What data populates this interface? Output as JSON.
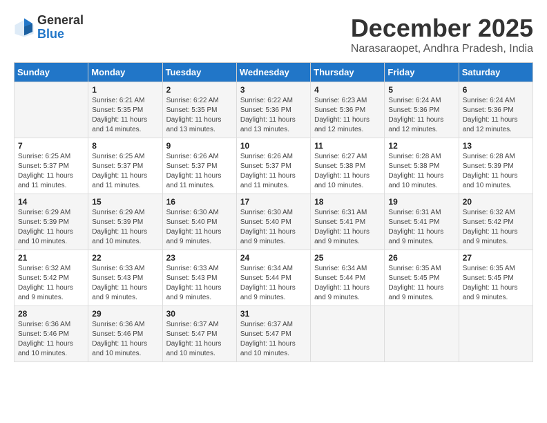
{
  "logo": {
    "general": "General",
    "blue": "Blue"
  },
  "title": "December 2025",
  "location": "Narasaraopet, Andhra Pradesh, India",
  "weekdays": [
    "Sunday",
    "Monday",
    "Tuesday",
    "Wednesday",
    "Thursday",
    "Friday",
    "Saturday"
  ],
  "weeks": [
    [
      {
        "day": "",
        "sunrise": "",
        "sunset": "",
        "daylight": ""
      },
      {
        "day": "1",
        "sunrise": "Sunrise: 6:21 AM",
        "sunset": "Sunset: 5:35 PM",
        "daylight": "Daylight: 11 hours and 14 minutes."
      },
      {
        "day": "2",
        "sunrise": "Sunrise: 6:22 AM",
        "sunset": "Sunset: 5:35 PM",
        "daylight": "Daylight: 11 hours and 13 minutes."
      },
      {
        "day": "3",
        "sunrise": "Sunrise: 6:22 AM",
        "sunset": "Sunset: 5:36 PM",
        "daylight": "Daylight: 11 hours and 13 minutes."
      },
      {
        "day": "4",
        "sunrise": "Sunrise: 6:23 AM",
        "sunset": "Sunset: 5:36 PM",
        "daylight": "Daylight: 11 hours and 12 minutes."
      },
      {
        "day": "5",
        "sunrise": "Sunrise: 6:24 AM",
        "sunset": "Sunset: 5:36 PM",
        "daylight": "Daylight: 11 hours and 12 minutes."
      },
      {
        "day": "6",
        "sunrise": "Sunrise: 6:24 AM",
        "sunset": "Sunset: 5:36 PM",
        "daylight": "Daylight: 11 hours and 12 minutes."
      }
    ],
    [
      {
        "day": "7",
        "sunrise": "Sunrise: 6:25 AM",
        "sunset": "Sunset: 5:37 PM",
        "daylight": "Daylight: 11 hours and 11 minutes."
      },
      {
        "day": "8",
        "sunrise": "Sunrise: 6:25 AM",
        "sunset": "Sunset: 5:37 PM",
        "daylight": "Daylight: 11 hours and 11 minutes."
      },
      {
        "day": "9",
        "sunrise": "Sunrise: 6:26 AM",
        "sunset": "Sunset: 5:37 PM",
        "daylight": "Daylight: 11 hours and 11 minutes."
      },
      {
        "day": "10",
        "sunrise": "Sunrise: 6:26 AM",
        "sunset": "Sunset: 5:37 PM",
        "daylight": "Daylight: 11 hours and 11 minutes."
      },
      {
        "day": "11",
        "sunrise": "Sunrise: 6:27 AM",
        "sunset": "Sunset: 5:38 PM",
        "daylight": "Daylight: 11 hours and 10 minutes."
      },
      {
        "day": "12",
        "sunrise": "Sunrise: 6:28 AM",
        "sunset": "Sunset: 5:38 PM",
        "daylight": "Daylight: 11 hours and 10 minutes."
      },
      {
        "day": "13",
        "sunrise": "Sunrise: 6:28 AM",
        "sunset": "Sunset: 5:39 PM",
        "daylight": "Daylight: 11 hours and 10 minutes."
      }
    ],
    [
      {
        "day": "14",
        "sunrise": "Sunrise: 6:29 AM",
        "sunset": "Sunset: 5:39 PM",
        "daylight": "Daylight: 11 hours and 10 minutes."
      },
      {
        "day": "15",
        "sunrise": "Sunrise: 6:29 AM",
        "sunset": "Sunset: 5:39 PM",
        "daylight": "Daylight: 11 hours and 10 minutes."
      },
      {
        "day": "16",
        "sunrise": "Sunrise: 6:30 AM",
        "sunset": "Sunset: 5:40 PM",
        "daylight": "Daylight: 11 hours and 9 minutes."
      },
      {
        "day": "17",
        "sunrise": "Sunrise: 6:30 AM",
        "sunset": "Sunset: 5:40 PM",
        "daylight": "Daylight: 11 hours and 9 minutes."
      },
      {
        "day": "18",
        "sunrise": "Sunrise: 6:31 AM",
        "sunset": "Sunset: 5:41 PM",
        "daylight": "Daylight: 11 hours and 9 minutes."
      },
      {
        "day": "19",
        "sunrise": "Sunrise: 6:31 AM",
        "sunset": "Sunset: 5:41 PM",
        "daylight": "Daylight: 11 hours and 9 minutes."
      },
      {
        "day": "20",
        "sunrise": "Sunrise: 6:32 AM",
        "sunset": "Sunset: 5:42 PM",
        "daylight": "Daylight: 11 hours and 9 minutes."
      }
    ],
    [
      {
        "day": "21",
        "sunrise": "Sunrise: 6:32 AM",
        "sunset": "Sunset: 5:42 PM",
        "daylight": "Daylight: 11 hours and 9 minutes."
      },
      {
        "day": "22",
        "sunrise": "Sunrise: 6:33 AM",
        "sunset": "Sunset: 5:43 PM",
        "daylight": "Daylight: 11 hours and 9 minutes."
      },
      {
        "day": "23",
        "sunrise": "Sunrise: 6:33 AM",
        "sunset": "Sunset: 5:43 PM",
        "daylight": "Daylight: 11 hours and 9 minutes."
      },
      {
        "day": "24",
        "sunrise": "Sunrise: 6:34 AM",
        "sunset": "Sunset: 5:44 PM",
        "daylight": "Daylight: 11 hours and 9 minutes."
      },
      {
        "day": "25",
        "sunrise": "Sunrise: 6:34 AM",
        "sunset": "Sunset: 5:44 PM",
        "daylight": "Daylight: 11 hours and 9 minutes."
      },
      {
        "day": "26",
        "sunrise": "Sunrise: 6:35 AM",
        "sunset": "Sunset: 5:45 PM",
        "daylight": "Daylight: 11 hours and 9 minutes."
      },
      {
        "day": "27",
        "sunrise": "Sunrise: 6:35 AM",
        "sunset": "Sunset: 5:45 PM",
        "daylight": "Daylight: 11 hours and 9 minutes."
      }
    ],
    [
      {
        "day": "28",
        "sunrise": "Sunrise: 6:36 AM",
        "sunset": "Sunset: 5:46 PM",
        "daylight": "Daylight: 11 hours and 10 minutes."
      },
      {
        "day": "29",
        "sunrise": "Sunrise: 6:36 AM",
        "sunset": "Sunset: 5:46 PM",
        "daylight": "Daylight: 11 hours and 10 minutes."
      },
      {
        "day": "30",
        "sunrise": "Sunrise: 6:37 AM",
        "sunset": "Sunset: 5:47 PM",
        "daylight": "Daylight: 11 hours and 10 minutes."
      },
      {
        "day": "31",
        "sunrise": "Sunrise: 6:37 AM",
        "sunset": "Sunset: 5:47 PM",
        "daylight": "Daylight: 11 hours and 10 minutes."
      },
      {
        "day": "",
        "sunrise": "",
        "sunset": "",
        "daylight": ""
      },
      {
        "day": "",
        "sunrise": "",
        "sunset": "",
        "daylight": ""
      },
      {
        "day": "",
        "sunrise": "",
        "sunset": "",
        "daylight": ""
      }
    ]
  ]
}
